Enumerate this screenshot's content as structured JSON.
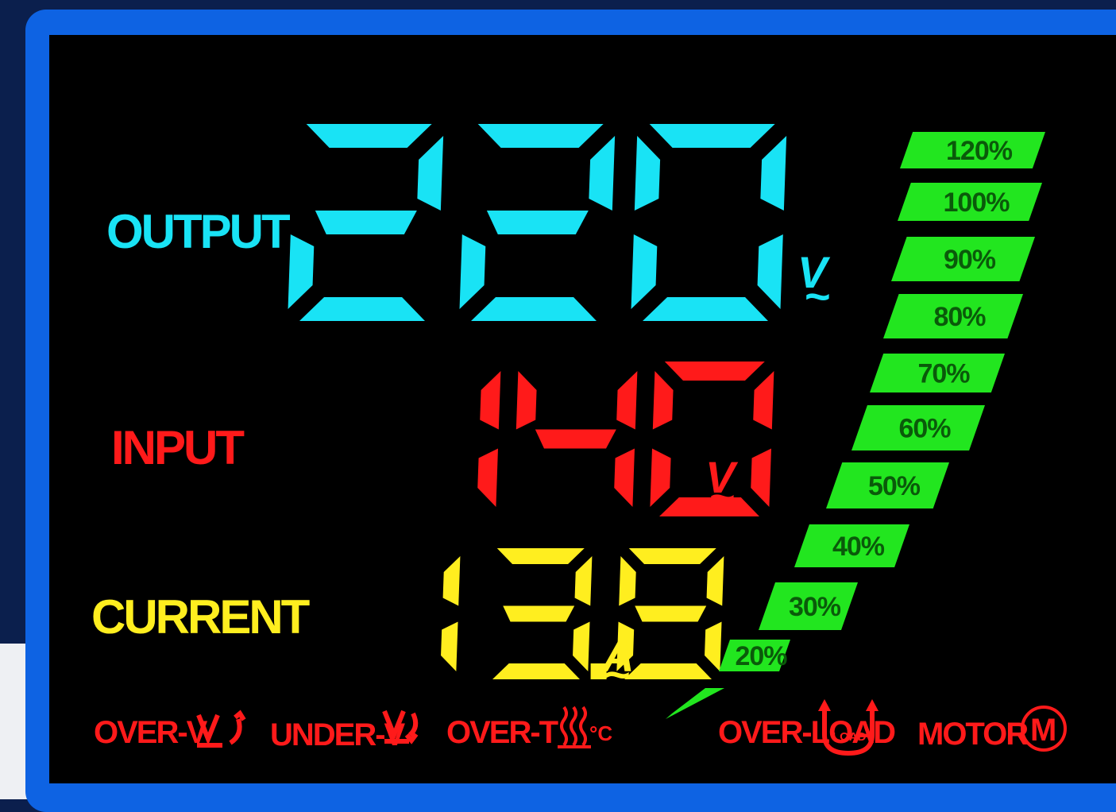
{
  "panel": {
    "output": {
      "label": "OUTPUT",
      "digits": "220",
      "unit": "V",
      "unit_sub": "~",
      "color": "#19e3f5"
    },
    "input": {
      "label": "INPUT",
      "digits": "140",
      "unit": "V",
      "unit_sub": "~",
      "color": "#ff1a1a"
    },
    "current": {
      "label": "CURRENT",
      "digits": "13.8",
      "unit": "A",
      "unit_sub": "~",
      "color": "#ffee1f"
    }
  },
  "load_bar": {
    "color": "#22e61f",
    "levels": [
      "20%",
      "30%",
      "40%",
      "50%",
      "60%",
      "70%",
      "80%",
      "90%",
      "100%",
      "120%"
    ]
  },
  "indicators": {
    "over_v": "OVER-V",
    "under_v": "UNDER-V",
    "over_t": "OVER-T",
    "temp_unit": "°C",
    "over_load": "OVER-LOAD",
    "load_icon_text": "LOAD",
    "motor": "MOTOR",
    "motor_icon_text": "M",
    "color": "#ff1a1a"
  }
}
